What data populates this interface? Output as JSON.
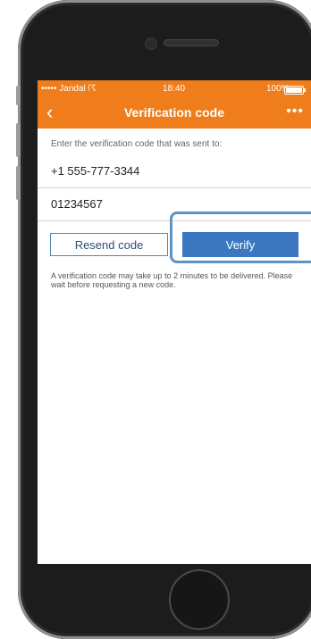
{
  "status_bar": {
    "carrier": "••••• Jandal ☈",
    "time": "18:40",
    "battery": "100%"
  },
  "nav_bar": {
    "back_icon": "‹",
    "title": "Verification code",
    "more_icon": "•••"
  },
  "form": {
    "prompt": "Enter the verification code that was sent to:",
    "phone_number": "+1 555-777-3344",
    "code_value": "01234567",
    "resend_label": "Resend code",
    "verify_label": "Verify",
    "notice": "A verification code may take up to 2 minutes to be delivered. Please wait before requesting a new code."
  },
  "colors": {
    "accent": "#f07d1b",
    "primary_button": "#3c78bf",
    "highlight": "#5c94c7"
  }
}
